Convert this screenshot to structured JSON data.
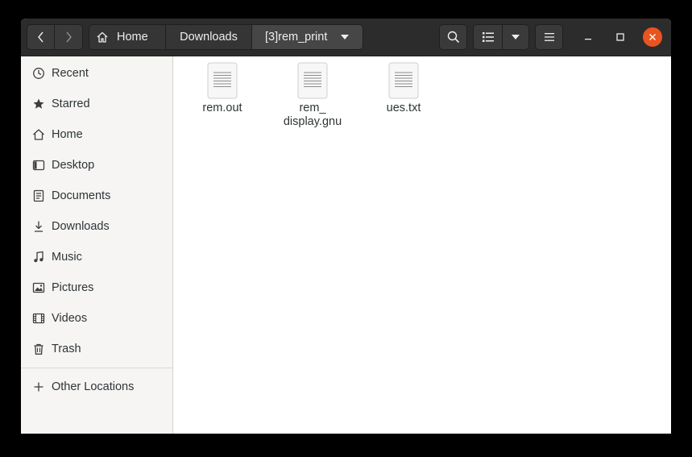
{
  "breadcrumb": {
    "home": "Home",
    "downloads": "Downloads",
    "current": "[3]rem_print"
  },
  "sidebar": {
    "items": [
      {
        "label": "Recent",
        "icon": "clock-icon"
      },
      {
        "label": "Starred",
        "icon": "star-icon"
      },
      {
        "label": "Home",
        "icon": "home-icon"
      },
      {
        "label": "Desktop",
        "icon": "desktop-icon"
      },
      {
        "label": "Documents",
        "icon": "document-icon"
      },
      {
        "label": "Downloads",
        "icon": "download-icon"
      },
      {
        "label": "Music",
        "icon": "music-icon"
      },
      {
        "label": "Pictures",
        "icon": "picture-icon"
      },
      {
        "label": "Videos",
        "icon": "video-icon"
      },
      {
        "label": "Trash",
        "icon": "trash-icon"
      }
    ],
    "other_locations": "Other Locations"
  },
  "files": [
    {
      "name": "rem.out"
    },
    {
      "name": "rem_\ndisplay.gnu"
    },
    {
      "name": "ues.txt"
    }
  ],
  "colors": {
    "headerbar": "#2c2c2c",
    "close_button": "#e95420",
    "sidebar_bg": "#f6f5f4"
  }
}
